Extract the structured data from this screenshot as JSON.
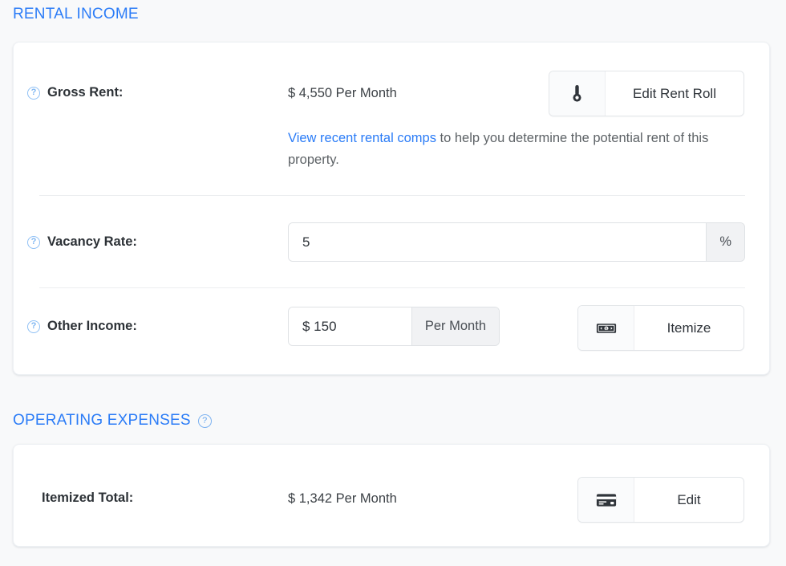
{
  "theme": {
    "page_bg": "#f8f9fa",
    "card_bg": "#ffffff",
    "accent_blue": "#2b7cf7",
    "link_blue": "#2b7cf7",
    "label_color": "#2c3136",
    "muted_text": "#5d6266",
    "addon_bg": "#f1f2f4"
  },
  "rental_income": {
    "heading": "RENTAL INCOME",
    "gross_rent": {
      "label": "Gross Rent:",
      "help_icon": "question-mark-circle-icon",
      "currency_symbol": "$",
      "amount": "4,550",
      "period": "Per Month",
      "value_display": "$ 4,550 Per Month",
      "button": {
        "label": "Edit Rent Roll",
        "icon": "thermometer-icon"
      },
      "description": {
        "link_text": "View recent rental comps",
        "rest_text": " to help you determine the potential rent of this property."
      }
    },
    "vacancy_rate": {
      "label": "Vacancy Rate:",
      "help_icon": "question-mark-circle-icon",
      "value": "5",
      "placeholder": "",
      "unit_suffix": "%"
    },
    "other_income": {
      "label": "Other Income:",
      "help_icon": "question-mark-circle-icon",
      "value": "$ 150",
      "placeholder": "",
      "period_addon": "Per Month",
      "button": {
        "label": "Itemize",
        "icon": "banknote-icon"
      }
    }
  },
  "operating_expenses": {
    "heading": "OPERATING EXPENSES",
    "help_icon": "question-mark-circle-icon",
    "itemized_total": {
      "label": "Itemized Total:",
      "currency_symbol": "$",
      "amount": "1,342",
      "period": "Per Month",
      "value_display": "$ 1,342 Per Month",
      "button": {
        "label": "Edit",
        "icon": "credit-card-icon"
      }
    }
  }
}
